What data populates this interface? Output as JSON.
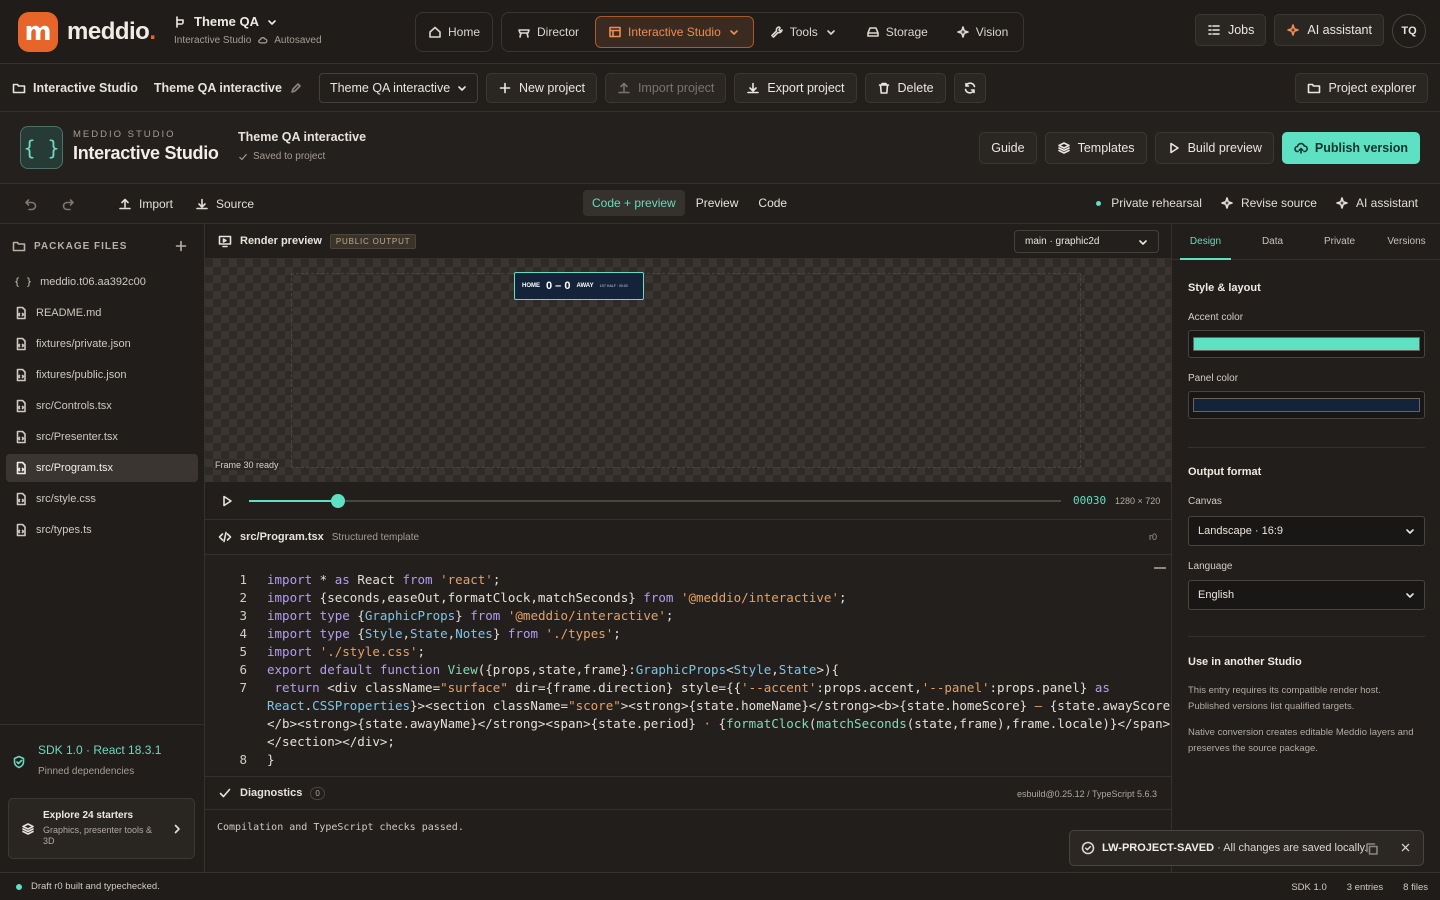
{
  "brand": {
    "name": "meddio",
    "dot": ".",
    "logo_letter": "m"
  },
  "workspace": {
    "title": "Theme QA",
    "subtitle": "Interactive Studio",
    "save_state": "Autosaved"
  },
  "nav": {
    "home": "Home",
    "director": "Director",
    "interactive_studio": "Interactive Studio",
    "tools": "Tools",
    "storage": "Storage",
    "vision": "Vision"
  },
  "topright": {
    "jobs": "Jobs",
    "ai_assistant": "AI assistant",
    "avatar": "TQ"
  },
  "projectbar": {
    "crumb_section": "Interactive Studio",
    "crumb_project": "Theme QA interactive",
    "project_select": "Theme QA interactive",
    "new_project": "New project",
    "import_project": "Import project",
    "export_project": "Export project",
    "delete": "Delete",
    "project_explorer": "Project explorer"
  },
  "studio": {
    "kicker": "MEDDIO STUDIO",
    "name": "Interactive Studio",
    "icon_glyph": "{ }",
    "project_name": "Theme QA interactive",
    "project_status": "Saved to project",
    "guide": "Guide",
    "templates": "Templates",
    "build_preview": "Build preview",
    "publish_version": "Publish version"
  },
  "toolbar": {
    "import": "Import",
    "source": "Source",
    "tabs": [
      "Code + preview",
      "Preview",
      "Code"
    ],
    "private_rehearsal": "Private rehearsal",
    "revise_source": "Revise source",
    "ai_assistant": "AI assistant"
  },
  "sidebar": {
    "header": "PACKAGE FILES",
    "files": [
      {
        "name": "meddio.t06.aa392c00",
        "icon": "braces-icon"
      },
      {
        "name": "README.md",
        "icon": "file-icon"
      },
      {
        "name": "fixtures/private.json",
        "icon": "file-icon"
      },
      {
        "name": "fixtures/public.json",
        "icon": "file-icon"
      },
      {
        "name": "src/Controls.tsx",
        "icon": "file-icon"
      },
      {
        "name": "src/Presenter.tsx",
        "icon": "file-icon"
      },
      {
        "name": "src/Program.tsx",
        "icon": "file-icon"
      },
      {
        "name": "src/style.css",
        "icon": "file-icon"
      },
      {
        "name": "src/types.ts",
        "icon": "file-icon"
      }
    ],
    "sdk_title": "SDK 1.0 · React 18.3.1",
    "sdk_subtitle": "Pinned dependencies",
    "starters_title": "Explore 24 starters",
    "starters_subtitle": "Graphics, presenter tools & 3D"
  },
  "preview": {
    "title": "Render preview",
    "badge": "PUBLIC OUTPUT",
    "target": "main · graphic2d",
    "frame_status": "Frame 30 ready",
    "frame_number": "00030",
    "resolution": "1280 × 720",
    "progress": 0.11,
    "scorebug": {
      "home_label": "HOME",
      "score": "0 – 0",
      "away_label": "AWAY",
      "period": "1ST HALF · 00:00"
    }
  },
  "editor": {
    "file": "src/Program.tsx",
    "subtitle": "Structured template",
    "revision": "r0",
    "line_numbers": [
      "1",
      "2",
      "3",
      "4",
      "5",
      "6",
      "7",
      "",
      "",
      "",
      "8"
    ]
  },
  "diagnostics": {
    "title": "Diagnostics",
    "count": "0",
    "tool": "esbuild@0.25.12 / TypeScript 5.6.3",
    "message": "Compilation and TypeScript checks passed."
  },
  "right": {
    "tabs": [
      "Design",
      "Data",
      "Private",
      "Versions"
    ],
    "style_title": "Style & layout",
    "accent_label": "Accent color",
    "accent_value": "#5ee0c2",
    "panel_label": "Panel color",
    "panel_value": "#14223a",
    "output_title": "Output format",
    "canvas_label": "Canvas",
    "canvas_value": "Landscape · 16:9",
    "language_label": "Language",
    "language_value": "English",
    "use_title": "Use in another Studio",
    "use_note_1": "This entry requires its compatible render host. Published versions list qualified targets.",
    "use_note_2": "Native conversion creates editable Meddio layers and preserves the source package."
  },
  "toast": {
    "code": "LW-PROJECT-SAVED",
    "message": "· All changes are saved locally."
  },
  "status": {
    "left": "Draft r0 built and typechecked.",
    "sdk": "SDK 1.0",
    "entries": "3 entries",
    "files": "8 files"
  }
}
